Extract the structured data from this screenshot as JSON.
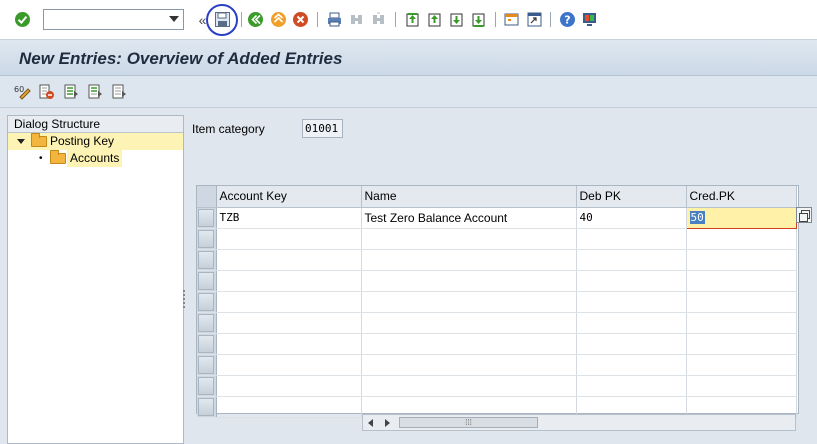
{
  "toolbar": {
    "command_field_value": "",
    "icons": [
      "enter-icon",
      "save-icon",
      "back-icon",
      "exit-icon",
      "cancel-icon",
      "print-icon",
      "find-icon",
      "find-next-icon",
      "first-page-icon",
      "previous-page-icon",
      "next-page-icon",
      "last-page-icon",
      "create-session-icon",
      "shortcut-icon",
      "help-icon",
      "customize-layout-icon"
    ]
  },
  "title": "New Entries: Overview of Added Entries",
  "app_toolbar": {
    "icons": [
      "display-change-icon",
      "delete-icon",
      "select-all-icon",
      "select-block-icon",
      "deselect-all-icon"
    ]
  },
  "dialog_structure": {
    "header": "Dialog Structure",
    "items": [
      {
        "label": "Posting Key"
      },
      {
        "label": "Accounts"
      }
    ]
  },
  "item_category": {
    "label": "Item category",
    "value": "01001"
  },
  "table": {
    "columns": [
      "Account Key",
      "Name",
      "Deb PK",
      "Cred.PK"
    ],
    "rows": [
      {
        "account_key": "TZB",
        "name": "Test Zero Balance Account",
        "deb_pk": "40",
        "cred_pk": "50"
      }
    ]
  },
  "colors": {
    "title_bg": "#d5e0eb",
    "highlight": "#fdf3b4",
    "active_cell": "#fff1a8",
    "save_circle": "#2a3fc7"
  }
}
